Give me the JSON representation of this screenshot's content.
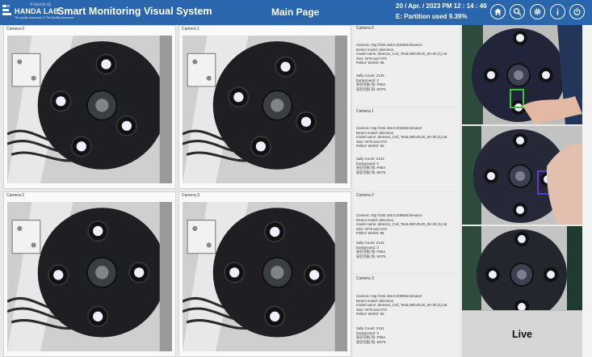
{
  "header": {
    "logo_small_text": "주식회사한다랩",
    "logo_name": "HANDA LAB",
    "logo_tagline": "The quality assurance & The Quality assurance",
    "app_title": "Smart Monitoring Visual System",
    "page_title": "Main Page",
    "datetime": "20 / Apr. / 2023   PM 12 : 14 : 46",
    "partition": "E: Partition used 9.39%",
    "buttons": [
      "home-icon",
      "search-icon",
      "gear-icon",
      "info-icon",
      "power-icon"
    ],
    "colors": {
      "bar": "#2a66ad",
      "text": "#ffffff"
    }
  },
  "cameras": [
    {
      "label": "Camera 0"
    },
    {
      "label": "Camera 1"
    },
    {
      "label": "Camera 2"
    },
    {
      "label": "Camera 3"
    }
  ],
  "info_panels": [
    {
      "title": "Camera 0",
      "details": [
        "Camera: rtsp://192.168.0.202554/stream2",
        "Detect model: detection",
        "model name: detector_Coil_TestLINEV0L00_0H.00 (1).rat",
        "Size: W76 and H73",
        "Pxiltut: WeitXt: 98"
      ],
      "stats": [
        "Sally Count: 2146",
        "background: 3",
        "불량검출(개): P664",
        "불량검출(개): M476"
      ]
    },
    {
      "title": "Camera 1",
      "details": [
        "Camera: rtsp://192.168.0.202554/stream2",
        "Detect model: detection",
        "model name: detector_Coil_TestLINEV0L00_0H.00 (1).rat",
        "Size: W76 and H73",
        "Pxiltut: WeitXt: 98"
      ],
      "stats": [
        "Sally Count: 2144",
        "background: 3",
        "불량검출(개): P664",
        "불량검출(개): M476"
      ]
    },
    {
      "title": "Camera 2",
      "details": [
        "Camera: rtsp://192.168.0.209554/stream2",
        "Detect model: detection",
        "model name: detector_Coil_TestLINEV0L00_0H.00 (1).rat",
        "Size: W76 and H73",
        "Pxiltut: WeitXt: 98"
      ],
      "stats": [
        "Sally Count: 2142",
        "background: 3",
        "불량검출(개): P664",
        "불량검출(개): M476"
      ]
    },
    {
      "title": "Camera 3",
      "details": [
        "Camera: rtsp://192.168.0.209554/stream2",
        "Detect model: detection",
        "model name: detector_Coil_TestLINEV0L00_0H.00 (1).rat",
        "Size: W76 and H73",
        "Pxiltut: WeitXt: 98"
      ],
      "stats": [
        "Sally Count: 2142",
        "background: 3",
        "불량검출(개): P664",
        "불량검출(개): M476"
      ]
    }
  ],
  "live_button": "Live"
}
